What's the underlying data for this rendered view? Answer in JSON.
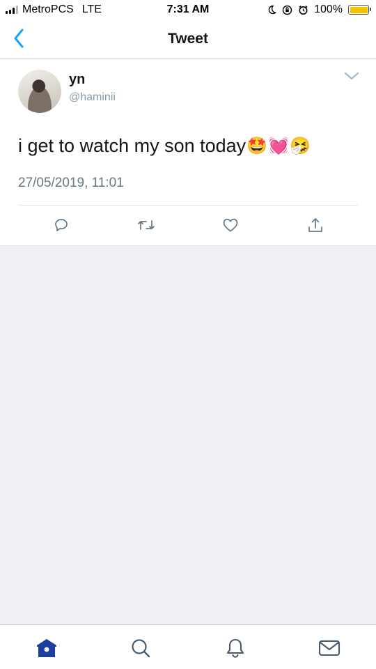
{
  "status_bar": {
    "carrier": "MetroPCS",
    "network": "LTE",
    "time": "7:31 AM",
    "battery_percent": "100%",
    "battery_level": 1.0
  },
  "nav": {
    "title": "Tweet",
    "back_icon": "chevron-left-icon"
  },
  "tweet": {
    "display_name": "yn",
    "handle": "@haminii",
    "text": "i get to watch my son today",
    "emojis": [
      "🤩",
      "💓",
      "🤧"
    ],
    "timestamp": "27/05/2019, 11:01",
    "actions": [
      "reply-icon",
      "retweet-icon",
      "like-icon",
      "share-icon"
    ]
  },
  "tab_bar": {
    "tabs": [
      "home-icon",
      "search-icon",
      "notifications-icon",
      "messages-icon"
    ],
    "active": "home-icon"
  },
  "colors": {
    "accent": "#1da1f2",
    "tab_active": "#1c3f9e",
    "tab_inactive": "#657786",
    "background_gray": "#efeff4"
  }
}
